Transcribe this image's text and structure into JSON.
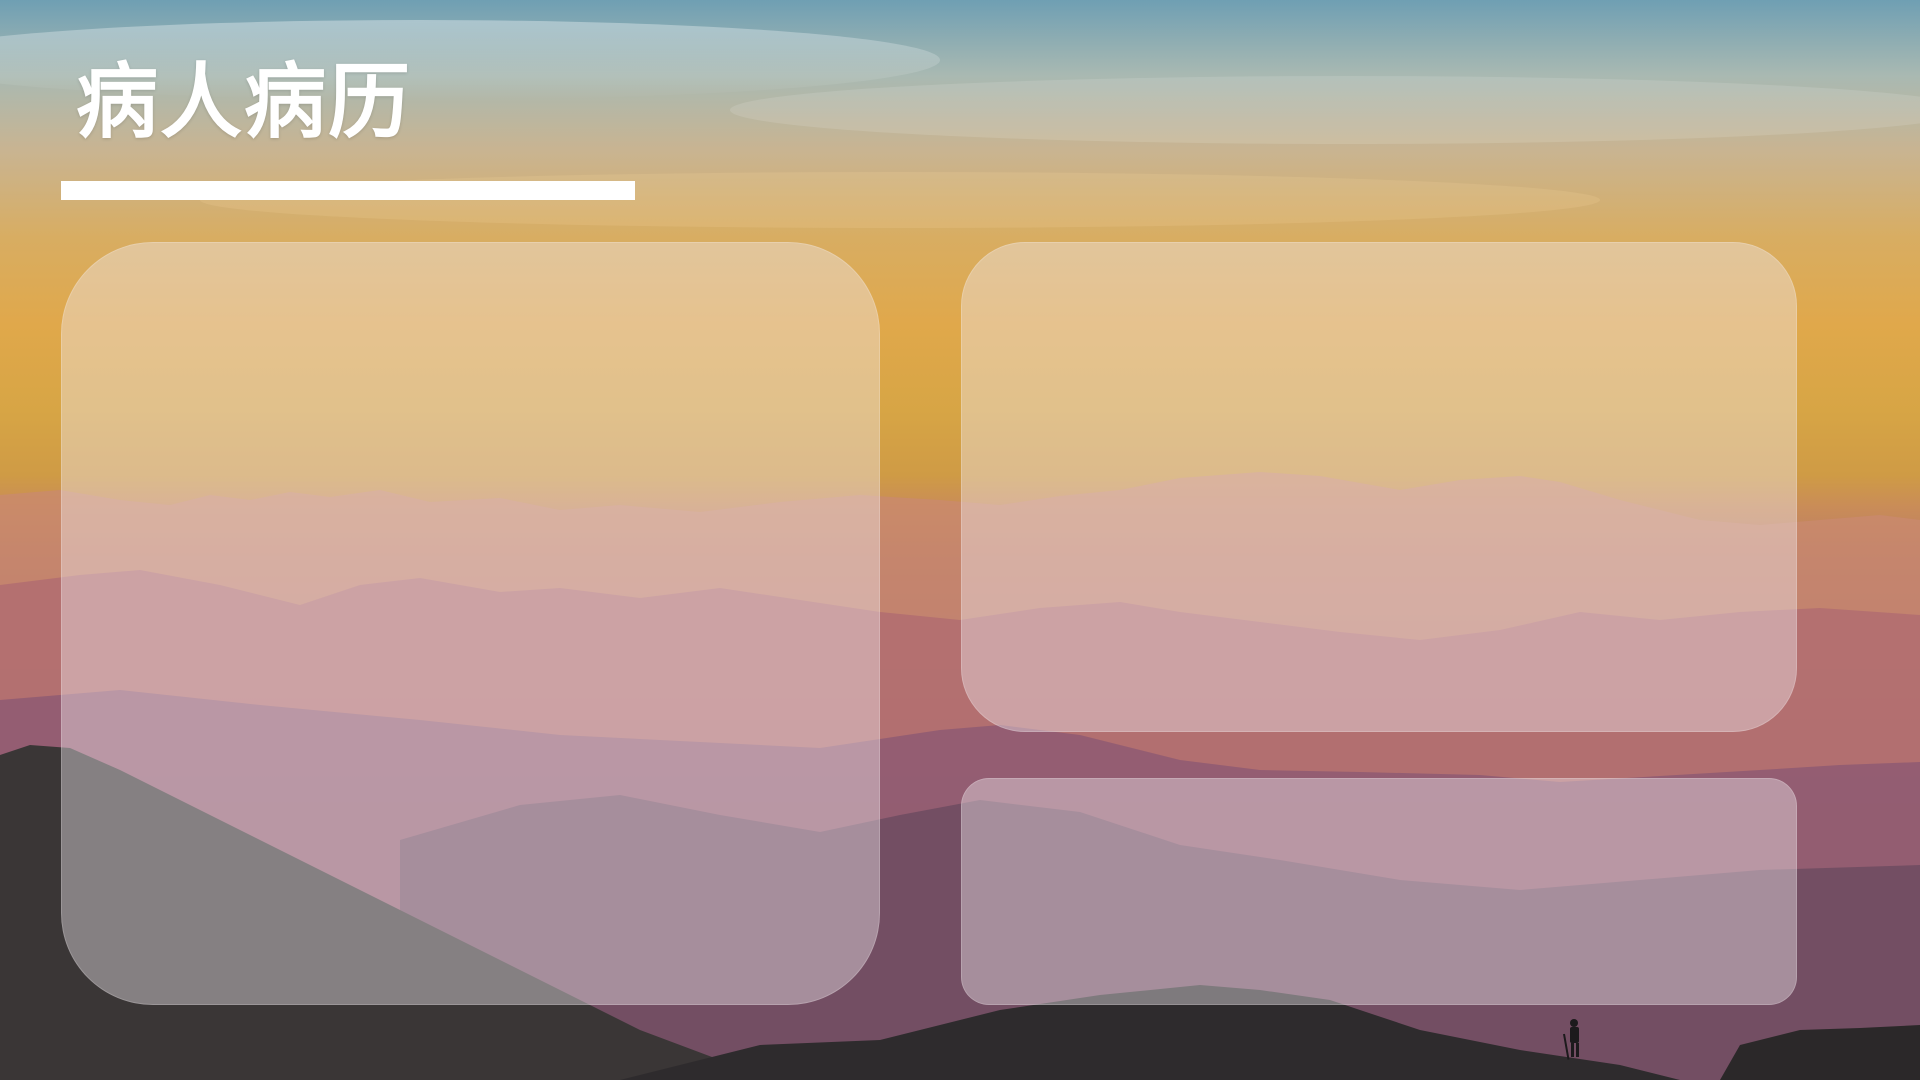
{
  "slide": {
    "title": "病人病历"
  },
  "colors": {
    "title_text": "#ffffff",
    "underline": "#ffffff",
    "panel_fill": "rgba(238,232,236,0.42)"
  },
  "panels": [
    {
      "name": "content-panel-left"
    },
    {
      "name": "content-panel-right-top"
    },
    {
      "name": "content-panel-right-bottom"
    }
  ]
}
